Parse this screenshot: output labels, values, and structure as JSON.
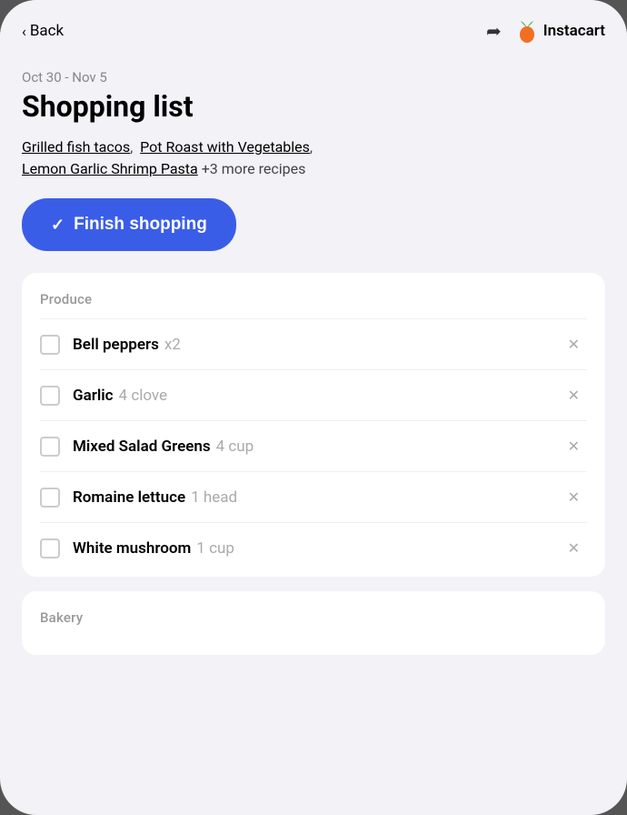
{
  "nav": {
    "back_label": "Back",
    "share_icon": "↪",
    "instacart_label": "Instacart"
  },
  "header": {
    "date_range": "Oct 30 - Nov 5",
    "title": "Shopping list",
    "recipes": [
      {
        "label": "Grilled fish tacos",
        "link": true
      },
      {
        "label": "Pot Roast with Vegetables",
        "link": true
      },
      {
        "label": "Lemon Garlic Shrimp Pasta",
        "link": true
      }
    ],
    "more_recipes": "+3 more recipes"
  },
  "finish_button": {
    "label": "Finish shopping",
    "check": "✓"
  },
  "sections": [
    {
      "title": "Produce",
      "items": [
        {
          "name": "Bell peppers",
          "qty": "x2"
        },
        {
          "name": "Garlic",
          "qty": "4 clove"
        },
        {
          "name": "Mixed Salad Greens",
          "qty": "4 cup"
        },
        {
          "name": "Romaine lettuce",
          "qty": "1 head"
        },
        {
          "name": "White mushroom",
          "qty": "1 cup"
        }
      ]
    },
    {
      "title": "Bakery",
      "items": []
    }
  ],
  "colors": {
    "accent": "#3a5de8",
    "carrot_body": "#f26f21",
    "carrot_leaves": "#3ab54a"
  }
}
